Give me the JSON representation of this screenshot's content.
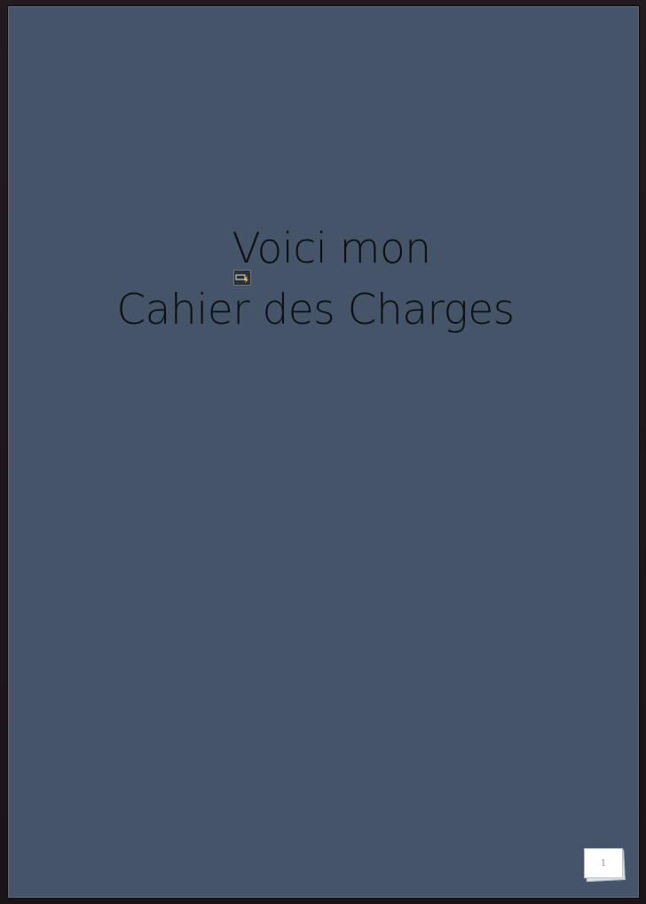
{
  "document": {
    "title_line1": "Voici mon",
    "title_line2": "Cahier des Charges",
    "page_number": "1"
  },
  "icons": {
    "anchor": "image-anchor-icon"
  },
  "colors": {
    "page_background": "#455469",
    "workspace_background": "#1c1418",
    "title_text": "#0e0f12"
  }
}
